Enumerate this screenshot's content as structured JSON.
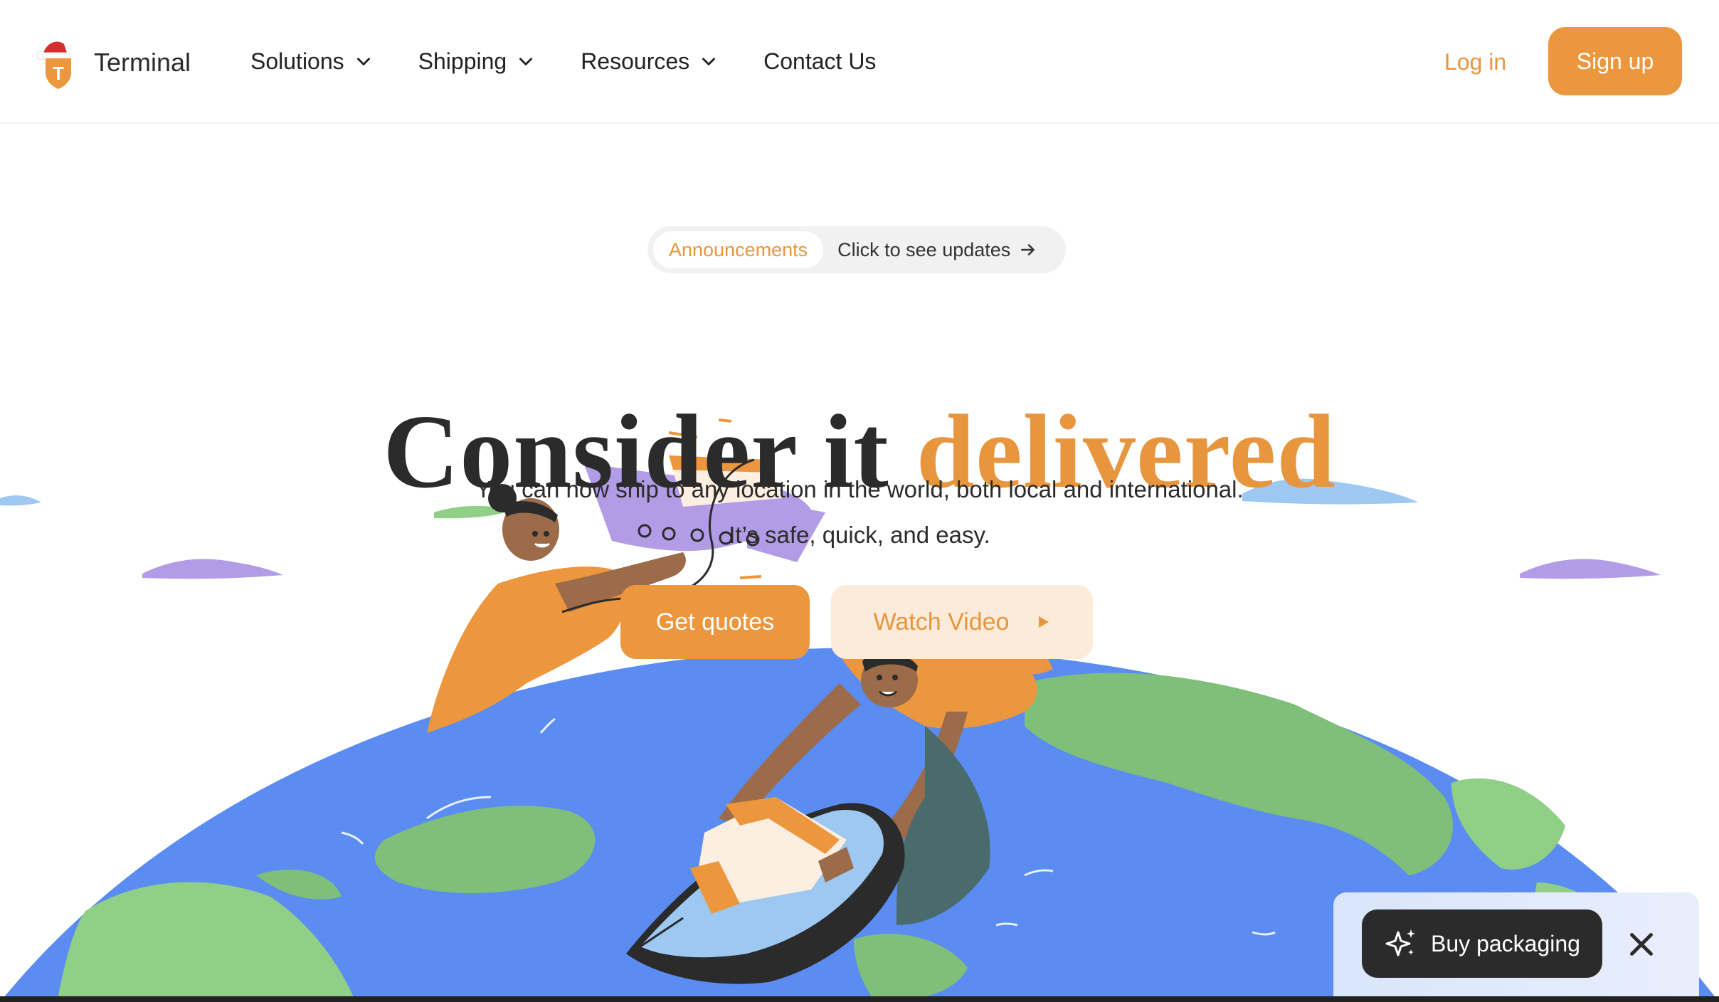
{
  "header": {
    "brand": "Terminal",
    "nav": [
      {
        "label": "Solutions",
        "has_dropdown": true
      },
      {
        "label": "Shipping",
        "has_dropdown": true
      },
      {
        "label": "Resources",
        "has_dropdown": true
      },
      {
        "label": "Contact Us",
        "has_dropdown": false
      }
    ],
    "login_label": "Log in",
    "signup_label": "Sign up"
  },
  "announcement": {
    "badge": "Announcements",
    "text": "Click to see updates",
    "icon": "arrow-right-icon"
  },
  "hero": {
    "title_main": "Consider it ",
    "title_accent": "delivered",
    "subtitle_line1": "You can now ship to any location in the world, both local and international.",
    "subtitle_line2": "It’s safe, quick, and easy.",
    "primary_cta": "Get quotes",
    "secondary_cta": "Watch  Video",
    "secondary_icon": "play-icon"
  },
  "widget": {
    "label": "Buy packaging",
    "icon": "sparkles-icon",
    "close_icon": "close-icon"
  },
  "colors": {
    "accent": "#ec963e",
    "accent_light": "#fcebd9",
    "text": "#2b2b2b",
    "ocean": "#5b8cf2",
    "land": "#7fbf7a",
    "widget_dark": "#2b2b2b"
  }
}
